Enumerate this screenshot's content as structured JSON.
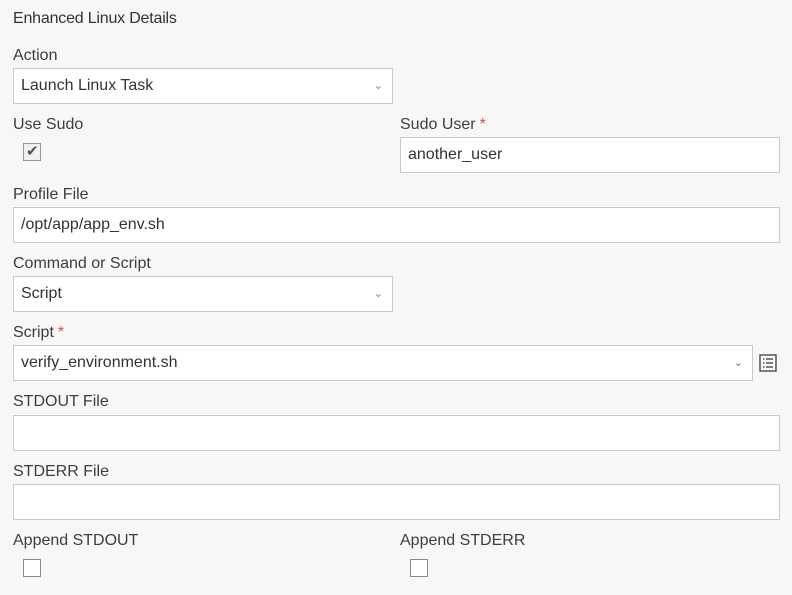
{
  "section": {
    "title": "Enhanced Linux Details"
  },
  "action": {
    "label": "Action",
    "value": "Launch Linux Task"
  },
  "use_sudo": {
    "label": "Use Sudo",
    "checked": true
  },
  "sudo_user": {
    "label": "Sudo User",
    "required_mark": "*",
    "value": "another_user"
  },
  "profile_file": {
    "label": "Profile File",
    "value": "/opt/app/app_env.sh"
  },
  "command_or_script": {
    "label": "Command or Script",
    "value": "Script"
  },
  "script": {
    "label": "Script",
    "required_mark": "*",
    "value": "verify_environment.sh",
    "browse_icon": "list-icon"
  },
  "stdout_file": {
    "label": "STDOUT File",
    "value": ""
  },
  "stderr_file": {
    "label": "STDERR File",
    "value": ""
  },
  "append_stdout": {
    "label": "Append STDOUT",
    "checked": false
  },
  "append_stderr": {
    "label": "Append STDERR",
    "checked": false
  },
  "icons": {
    "dropdown": "chevron-down-icon",
    "check": "checkmark-icon"
  },
  "colors": {
    "required": "#d9534f",
    "background": "#f7f7f7",
    "border": "#c9c9c9"
  }
}
